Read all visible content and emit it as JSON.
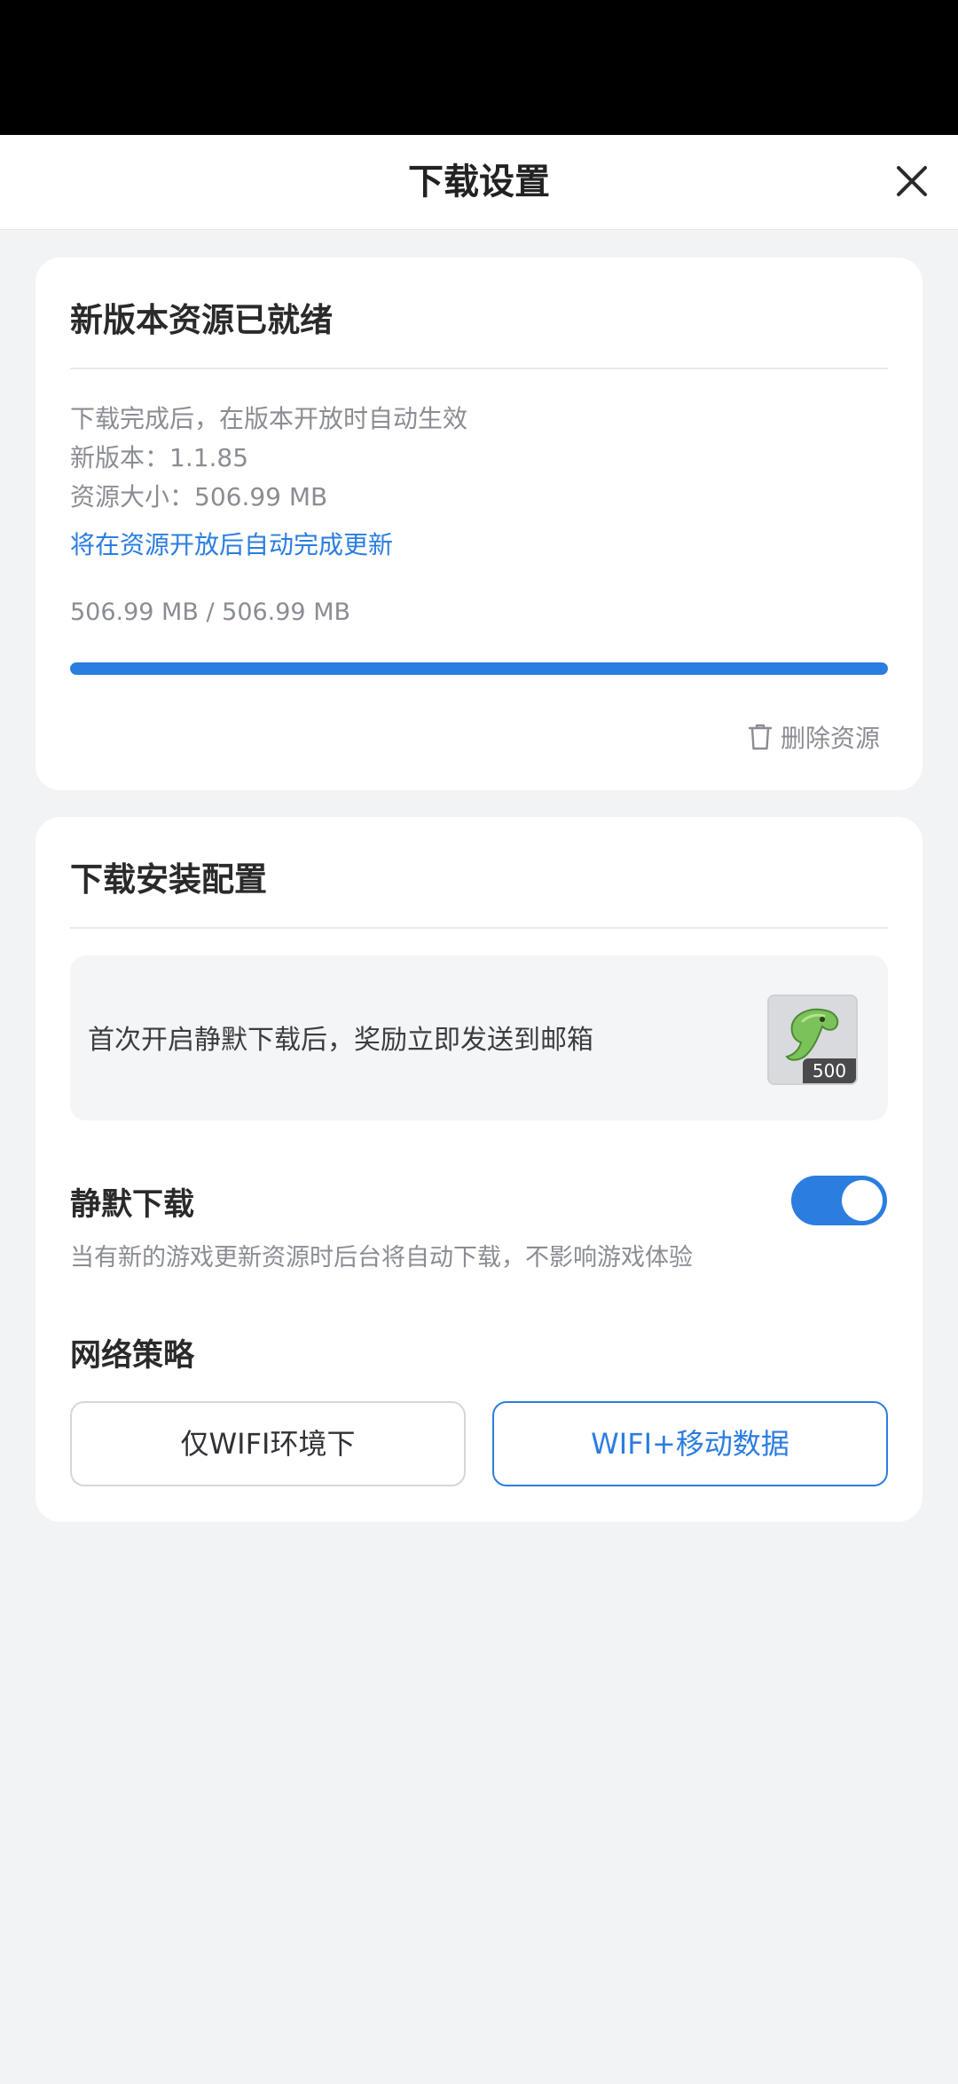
{
  "header": {
    "title": "下载设置",
    "close_icon": "close-icon"
  },
  "resource_card": {
    "title": "新版本资源已就绪",
    "line_1": "下载完成后，在版本开放时自动生效",
    "line_2": "新版本：1.1.85",
    "line_3": "资源大小：506.99 MB",
    "link": "将在资源开放后自动完成更新",
    "progress_text": "506.99 MB / 506.99 MB",
    "progress_fraction": 1.0,
    "delete_label": "删除资源",
    "delete_icon": "trash-icon"
  },
  "install_card": {
    "title": "下载安装配置",
    "reward_text": "首次开启静默下载后，奖励立即发送到邮箱",
    "reward_count": "500",
    "reward_icon": "green-creature-item-icon",
    "silent_label": "静默下载",
    "silent_desc": "当有新的游戏更新资源时后台将自动下载，不影响游戏体验",
    "silent_enabled": true,
    "network_label": "网络策略",
    "options": [
      {
        "label": "仅WIFI环境下",
        "selected": false
      },
      {
        "label": "WIFI+移动数据",
        "selected": true
      }
    ]
  },
  "colors": {
    "accent": "#2b7de0",
    "background": "#f2f3f5",
    "card": "#ffffff",
    "muted_text": "#8a8d93"
  }
}
